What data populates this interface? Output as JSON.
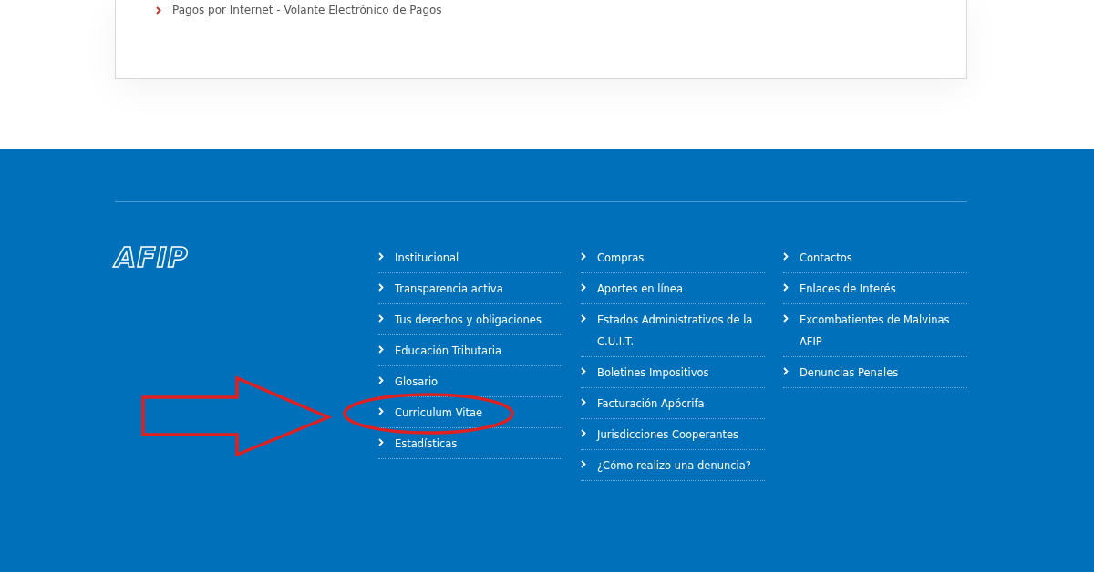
{
  "card": {
    "links": [
      "Pagos por Internet - Volante Electrónico de Pagos"
    ]
  },
  "footer": {
    "logo": "AFIP",
    "columns": [
      [
        "Institucional",
        "Transparencia activa",
        "Tus derechos y obligaciones",
        "Educación Tributaria",
        "Glosario",
        "Curriculum Vitae",
        "Estadísticas"
      ],
      [
        "Compras",
        "Aportes en línea",
        "Estados Administrativos de la C.U.I.T.",
        "Boletines Impositivos",
        "Facturación Apócrifa",
        "Jurisdicciones Cooperantes",
        "¿Cómo realizo una denuncia?"
      ],
      [
        "Contactos",
        "Enlaces de Interés",
        "Excombatientes de Malvinas AFIP",
        "Denuncias Penales"
      ]
    ]
  }
}
